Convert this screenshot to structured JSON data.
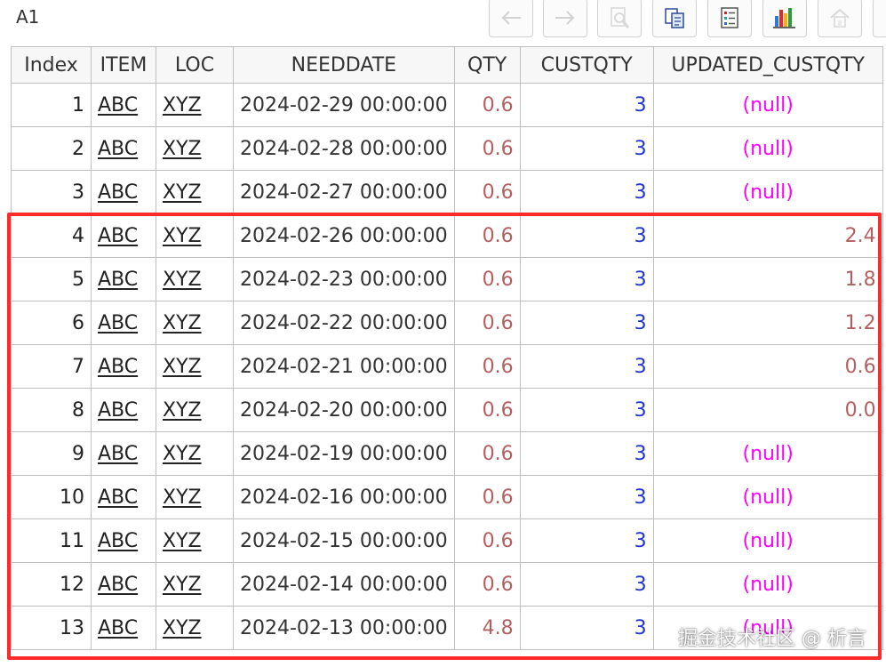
{
  "cell_name": "A1",
  "toolbar": [
    "back-icon",
    "forward-icon",
    "preview-icon",
    "copy-icon",
    "list-icon",
    "chart-icon",
    "home-icon"
  ],
  "columns": [
    "Index",
    "ITEM",
    "LOC",
    "NEEDDATE",
    "QTY",
    "CUSTQTY",
    "UPDATED_CUSTQTY"
  ],
  "rows": [
    [
      "1",
      "ABC",
      "XYZ",
      "2024-02-29 00:00:00",
      "0.6",
      "3",
      "(null)"
    ],
    [
      "2",
      "ABC",
      "XYZ",
      "2024-02-28 00:00:00",
      "0.6",
      "3",
      "(null)"
    ],
    [
      "3",
      "ABC",
      "XYZ",
      "2024-02-27 00:00:00",
      "0.6",
      "3",
      "(null)"
    ],
    [
      "4",
      "ABC",
      "XYZ",
      "2024-02-26 00:00:00",
      "0.6",
      "3",
      "2.4"
    ],
    [
      "5",
      "ABC",
      "XYZ",
      "2024-02-23 00:00:00",
      "0.6",
      "3",
      "1.8"
    ],
    [
      "6",
      "ABC",
      "XYZ",
      "2024-02-22 00:00:00",
      "0.6",
      "3",
      "1.2"
    ],
    [
      "7",
      "ABC",
      "XYZ",
      "2024-02-21 00:00:00",
      "0.6",
      "3",
      "0.6"
    ],
    [
      "8",
      "ABC",
      "XYZ",
      "2024-02-20 00:00:00",
      "0.6",
      "3",
      "0.0"
    ],
    [
      "9",
      "ABC",
      "XYZ",
      "2024-02-19 00:00:00",
      "0.6",
      "3",
      "(null)"
    ],
    [
      "10",
      "ABC",
      "XYZ",
      "2024-02-16 00:00:00",
      "0.6",
      "3",
      "(null)"
    ],
    [
      "11",
      "ABC",
      "XYZ",
      "2024-02-15 00:00:00",
      "0.6",
      "3",
      "(null)"
    ],
    [
      "12",
      "ABC",
      "XYZ",
      "2024-02-14 00:00:00",
      "0.6",
      "3",
      "(null)"
    ],
    [
      "13",
      "ABC",
      "XYZ",
      "2024-02-13 00:00:00",
      "4.8",
      "3",
      "(null)"
    ]
  ],
  "colors": {
    "highlight": "#ff2a2a",
    "null_text": "#ff00ff",
    "number_text": "#b45f5f",
    "custqty_text": "#1f33d6"
  },
  "watermark": "掘金技术社区 @ 析言"
}
